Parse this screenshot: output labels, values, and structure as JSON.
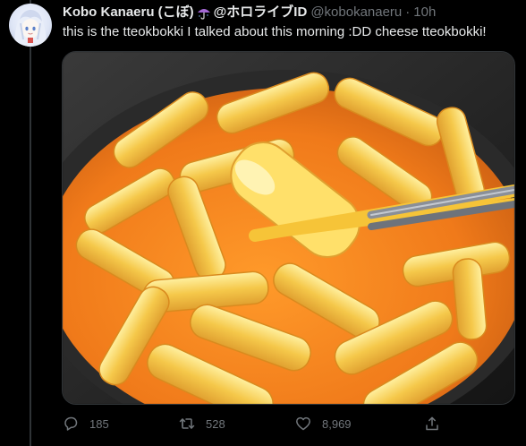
{
  "tweet": {
    "display_name": "Kobo Kanaeru (こぼ)",
    "emoji_icon": "umbrella-icon",
    "org_tag": "@ホロライブID",
    "handle": "@kobokanaeru",
    "separator": "·",
    "time": "10h",
    "text": "this is the tteokbokki I talked about this morning :DD cheese tteokbokki!"
  },
  "media": {
    "subject": "cheese tteokbokki in orange sauce held with chopsticks",
    "colors": {
      "sauce": "#f07a1a",
      "rice_cake": "#f5c84a",
      "pan": "#2a2a2a"
    }
  },
  "actions": {
    "reply_count": "185",
    "retweet_count": "528",
    "like_count": "8,969",
    "icons": [
      "reply-icon",
      "retweet-icon",
      "like-icon",
      "share-icon"
    ]
  },
  "colors": {
    "background": "#000000",
    "text_primary": "#e7e9ea",
    "text_secondary": "#71767b",
    "divider": "#2f3336"
  }
}
